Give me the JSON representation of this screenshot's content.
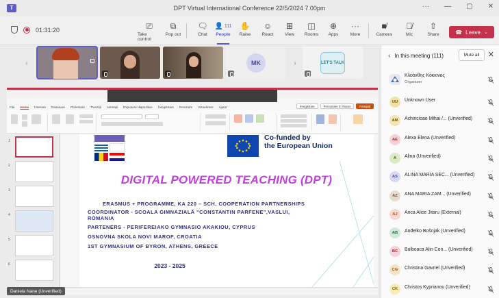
{
  "window": {
    "title": "DPT Virtual International Conference 22/5/2024 7.00pm",
    "minimize": "—",
    "maximize": "▢",
    "close": "✕"
  },
  "toolbar": {
    "timer": "01:31:20",
    "take_control": "Take control",
    "pop_out": "Pop out",
    "chat": "Chat",
    "people": "People",
    "people_count": "111",
    "raise": "Raise",
    "react": "React",
    "view": "View",
    "rooms": "Rooms",
    "apps": "Apps",
    "more": "More",
    "camera": "Camera",
    "mic": "Mic",
    "share": "Share",
    "leave": "Leave"
  },
  "video_strip": {
    "tiles": [
      {
        "kind": "video",
        "bg": "#8a7f86"
      },
      {
        "kind": "video",
        "bg": "#6d5a4f"
      },
      {
        "kind": "video",
        "bg": "#7d6b5a"
      },
      {
        "kind": "avatar",
        "initials": "MK"
      },
      {
        "kind": "logo",
        "text": "LET'S TALK"
      }
    ]
  },
  "shared_screen": {
    "menu": [
      "File",
      "Home",
      "Inserare",
      "Desenare",
      "Proiectare",
      "Tranziții",
      "Animații",
      "Expunere diapozitive",
      "Înregistrare",
      "Revizuire",
      "Vizualizare",
      "Ajutor"
    ],
    "menu_active": "Home",
    "actions": [
      "Înregistrare",
      "Prezentare în Teams",
      "Partajați"
    ],
    "slide": {
      "eu_text_1": "Co-funded by",
      "eu_text_2": "the European Union",
      "title": "DIGITAL POWERED TEACHING (DPT)",
      "line1": "ERASMUS + PROGRAMME, KA 220 – SCH, COOPERATION PARTNERSHIPS",
      "line2": "COORDINATOR - SCOALA GIMNAZIALĂ \"CONSTANTIN PARFENE\",VASLUI,",
      "line3": "ROMANIA",
      "line4": "PARTENERS - PERIFEREIAKO GYMNASIO AKAKIOU, CYPRUS",
      "line5": "OSNOVNA SKOLA NOVI MAROF, CROATIA",
      "line6": "1ST GYMNASIUM OF BYRON, ATHENS, GREECE",
      "years": "2023 - 2025"
    },
    "presenter": "Daniela Nane (Unverified)"
  },
  "panel": {
    "title": "In this meeting",
    "count": "(111)",
    "mute_all": "Mute all",
    "people": [
      {
        "name": "Κλεάνθης Κόκκινος",
        "role": "Organizer",
        "initials": "",
        "avatar_bg": "#e8e8f5",
        "avatar_fg": "#444791",
        "type": "photo"
      },
      {
        "name": "Unknown User",
        "initials": "UU",
        "avatar_bg": "#f1e0a8",
        "avatar_fg": "#7a5a00"
      },
      {
        "name": "Achiricioae Mihai /... (Unverified)",
        "initials": "AM",
        "avatar_bg": "#f3e6b3",
        "avatar_fg": "#6d5700"
      },
      {
        "name": "Alexa Elena (Unverified)",
        "initials": "AE",
        "avatar_bg": "#f4d1d7",
        "avatar_fg": "#a4262c"
      },
      {
        "name": "Alina (Unverified)",
        "initials": "A",
        "avatar_bg": "#dbe9c6",
        "avatar_fg": "#3b6e0b"
      },
      {
        "name": "ALINA MARIA SEC... (Unverified)",
        "initials": "AS",
        "avatar_bg": "#d7d9f2",
        "avatar_fg": "#444791"
      },
      {
        "name": "ANA MARIA ZAM... (Unverified)",
        "initials": "AZ",
        "avatar_bg": "#e5dccf",
        "avatar_fg": "#6b5337"
      },
      {
        "name": "Anca Alice Jitaru (External)",
        "initials": "AJ",
        "avatar_bg": "#f6d9cf",
        "avatar_fg": "#b5471c"
      },
      {
        "name": "Anđelko Bošnjak (Unverified)",
        "initials": "AB",
        "avatar_bg": "#cfe8da",
        "avatar_fg": "#1f6b3a"
      },
      {
        "name": "Bulboaca Alin Con... (Unverified)",
        "initials": "BC",
        "avatar_bg": "#f6d3da",
        "avatar_fg": "#a4262c"
      },
      {
        "name": "Christina Gavriel (Unverified)",
        "initials": "CG",
        "avatar_bg": "#f7e3c6",
        "avatar_fg": "#8a5b00"
      },
      {
        "name": "Christos Kyprianou (Unverified)",
        "initials": "CK",
        "avatar_bg": "#f7ecb5",
        "avatar_fg": "#7a6400"
      }
    ]
  },
  "colors": {
    "accent": "#5b5fc7",
    "leave": "#c4314b",
    "slide_title": "#c13fdb",
    "slide_text": "#2d2d8a",
    "eu_blue": "#0f47af"
  }
}
